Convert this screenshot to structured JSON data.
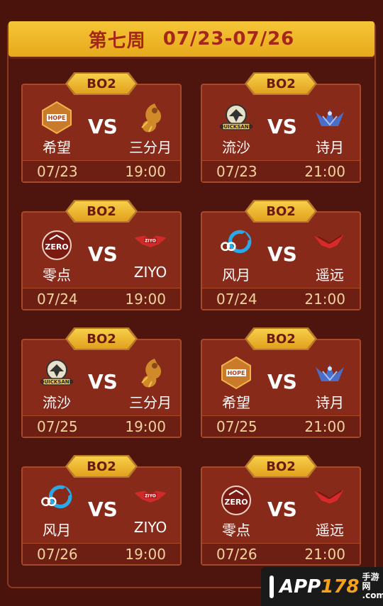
{
  "header": {
    "week": "第七周",
    "range": "07/23-07/26"
  },
  "matches": [
    {
      "format": "BO2",
      "team1": {
        "name": "希望",
        "logo": "hope-logo"
      },
      "team2": {
        "name": "三分月",
        "logo": "sanfenyue-logo"
      },
      "vs": "VS",
      "date": "07/23",
      "time": "19:00"
    },
    {
      "format": "BO2",
      "team1": {
        "name": "流沙",
        "logo": "quicksand-logo"
      },
      "team2": {
        "name": "诗月",
        "logo": "shiyue-logo"
      },
      "vs": "VS",
      "date": "07/23",
      "time": "21:00"
    },
    {
      "format": "BO2",
      "team1": {
        "name": "零点",
        "logo": "zero-logo"
      },
      "team2": {
        "name": "ZIYO",
        "logo": "ziyo-logo"
      },
      "vs": "VS",
      "date": "07/24",
      "time": "19:00"
    },
    {
      "format": "BO2",
      "team1": {
        "name": "风月",
        "logo": "fengyue-logo"
      },
      "team2": {
        "name": "遥远",
        "logo": "yaoyuan-logo"
      },
      "vs": "VS",
      "date": "07/24",
      "time": "21:00"
    },
    {
      "format": "BO2",
      "team1": {
        "name": "流沙",
        "logo": "quicksand-logo"
      },
      "team2": {
        "name": "三分月",
        "logo": "sanfenyue-logo"
      },
      "vs": "VS",
      "date": "07/25",
      "time": "19:00"
    },
    {
      "format": "BO2",
      "team1": {
        "name": "希望",
        "logo": "hope-logo"
      },
      "team2": {
        "name": "诗月",
        "logo": "shiyue-logo"
      },
      "vs": "VS",
      "date": "07/25",
      "time": "21:00"
    },
    {
      "format": "BO2",
      "team1": {
        "name": "风月",
        "logo": "fengyue-logo"
      },
      "team2": {
        "name": "ZIYO",
        "logo": "ziyo-logo"
      },
      "vs": "VS",
      "date": "07/26",
      "time": "19:00"
    },
    {
      "format": "BO2",
      "team1": {
        "name": "零点",
        "logo": "zero-logo"
      },
      "team2": {
        "name": "遥远",
        "logo": "yaoyuan-logo"
      },
      "vs": "VS",
      "date": "07/26",
      "time": "21:00"
    }
  ],
  "watermark": {
    "app": "APP",
    "num": "178",
    "suffix_top": "手游网",
    "suffix_bottom": ".com"
  },
  "colors": {
    "background": "#4a140d",
    "card": "#882a1a",
    "gold": "#f2bd2e",
    "title_red": "#a4271a",
    "footer_text": "#f4d3a0"
  }
}
